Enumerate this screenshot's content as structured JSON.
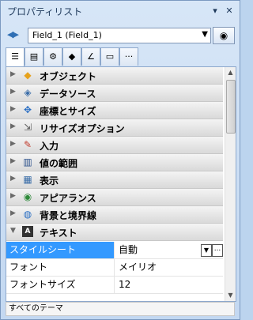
{
  "window": {
    "title": "プロパティリスト"
  },
  "selector": {
    "value": "Field_1 (Field_1)"
  },
  "tabs": [
    {
      "icon": "property-list-icon"
    },
    {
      "icon": "book-icon"
    },
    {
      "icon": "gear-icon"
    },
    {
      "icon": "shapes-icon"
    },
    {
      "icon": "graph-icon"
    },
    {
      "icon": "monitor-icon"
    },
    {
      "icon": "more-icon",
      "label": "···"
    }
  ],
  "categories": [
    {
      "label": "オブジェクト",
      "icon": "object-cube-icon",
      "glyph": "◆"
    },
    {
      "label": "データソース",
      "icon": "datasource-icon",
      "glyph": "◈"
    },
    {
      "label": "座標とサイズ",
      "icon": "coordinates-icon",
      "glyph": "✥"
    },
    {
      "label": "リサイズオプション",
      "icon": "resize-icon",
      "glyph": "⇲"
    },
    {
      "label": "入力",
      "icon": "input-icon",
      "glyph": "✎"
    },
    {
      "label": "値の範囲",
      "icon": "range-icon",
      "glyph": "▥"
    },
    {
      "label": "表示",
      "icon": "display-icon",
      "glyph": "▦"
    },
    {
      "label": "アピアランス",
      "icon": "eye-icon",
      "glyph": "◉"
    },
    {
      "label": "背景と境界線",
      "icon": "background-border-icon",
      "glyph": "◍"
    },
    {
      "label": "テキスト",
      "icon": "text-icon",
      "glyph": "A"
    }
  ],
  "properties": [
    {
      "name": "スタイルシート",
      "value": "自動"
    },
    {
      "name": "フォント",
      "value": "メイリオ"
    },
    {
      "name": "フォントサイズ",
      "value": "12"
    }
  ],
  "status": {
    "text": "すべてのテーマ"
  },
  "colors": {
    "selection": "#3399ff",
    "window_border": "#7b99c0"
  }
}
